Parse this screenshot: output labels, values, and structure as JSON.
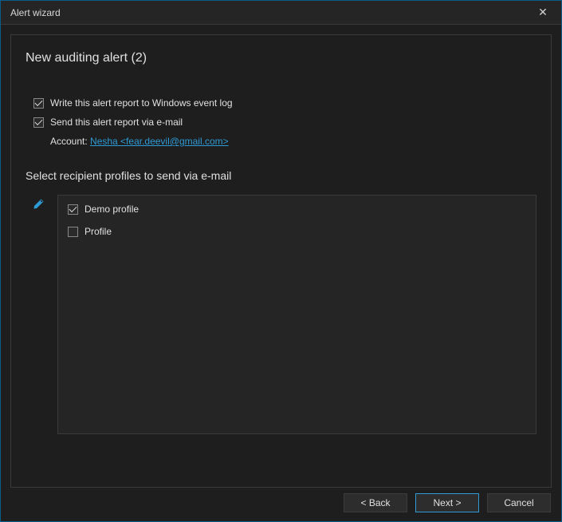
{
  "titlebar": {
    "title": "Alert wizard"
  },
  "page": {
    "title": "New auditing alert (2)"
  },
  "options": {
    "write_event_log": {
      "label": "Write this alert report to Windows event log",
      "checked": true
    },
    "send_email": {
      "label": "Send this alert report via e-mail",
      "checked": true
    },
    "account": {
      "label": "Account: ",
      "link_text": "Nesha <fear.deevil@gmail.com>"
    }
  },
  "profiles_section": {
    "title": "Select recipient profiles to send via e-mail",
    "items": [
      {
        "label": "Demo profile",
        "checked": true
      },
      {
        "label": "Profile",
        "checked": false
      }
    ]
  },
  "buttons": {
    "back": "< Back",
    "next": "Next >",
    "cancel": "Cancel"
  }
}
